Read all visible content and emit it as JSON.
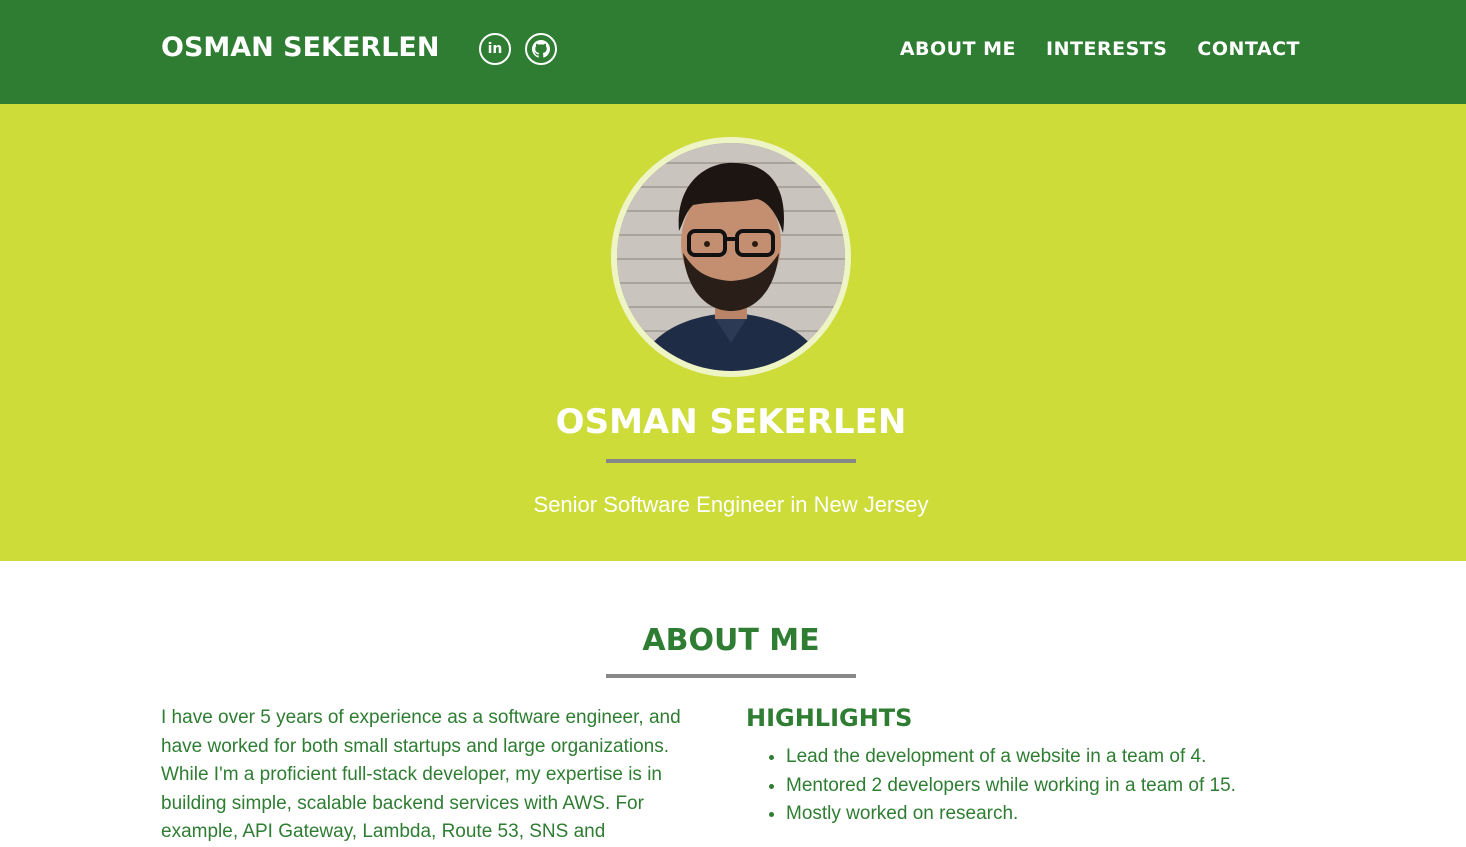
{
  "navbar": {
    "brand": "OSMAN SEKERLEN",
    "social": [
      {
        "icon": "linkedin-icon",
        "glyph": "in"
      },
      {
        "icon": "github-icon"
      }
    ],
    "links": [
      "ABOUT ME",
      "INTERESTS",
      "CONTACT"
    ]
  },
  "hero": {
    "name": "OSMAN SEKERLEN",
    "subtitle": "Senior Software Engineer in New Jersey"
  },
  "about": {
    "title": "ABOUT ME",
    "paragraph": "I have over 5 years of experience as a software engineer, and have worked for both small startups and large organizations. While I'm a proficient full-stack developer, my expertise is in building simple, scalable backend services with AWS. For example, API Gateway, Lambda, Route 53, SNS and",
    "highlights_title": "HIGHLIGHTS",
    "highlights": [
      "Lead the development of a website in a team of 4.",
      "Mentored 2 developers while working in a team of 15.",
      "Mostly worked on research."
    ]
  },
  "colors": {
    "navbar": "#2e7d32",
    "hero": "#cddc39",
    "accent_text": "#2e7d32",
    "divider": "#888888"
  }
}
